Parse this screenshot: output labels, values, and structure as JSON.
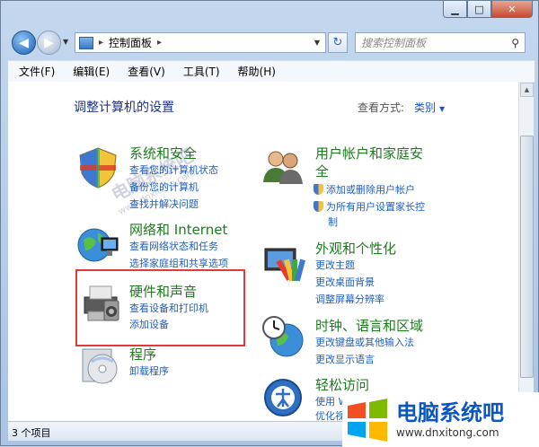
{
  "window": {
    "minimize": "▁",
    "maximize": "□",
    "close": "✕"
  },
  "nav": {
    "address": "控制面板",
    "address_sep": "▸",
    "search_placeholder": "搜索控制面板"
  },
  "menu": [
    "文件(F)",
    "编辑(E)",
    "查看(V)",
    "工具(T)",
    "帮助(H)"
  ],
  "content": {
    "heading": "调整计算机的设置",
    "view_by_label": "查看方式:",
    "view_by_value": "类别",
    "categories": [
      {
        "title": "系统和安全",
        "links": [
          "查看您的计算机状态",
          "备份您的计算机",
          "查找并解决问题"
        ]
      },
      {
        "title": "网络和 Internet",
        "links": [
          "查看网络状态和任务",
          "选择家庭组和共享选项"
        ]
      },
      {
        "title": "硬件和声音",
        "links": [
          "查看设备和打印机",
          "添加设备"
        ]
      },
      {
        "title": "程序",
        "links": [
          "卸载程序"
        ]
      },
      {
        "title_line1": "用户帐户和家庭安",
        "title_line2": "全",
        "links": [
          "添加或删除用户帐户",
          "为所有用户设置家长控",
          "制"
        ]
      },
      {
        "title": "外观和个性化",
        "links": [
          "更改主题",
          "更改桌面背景",
          "调整屏幕分辨率"
        ]
      },
      {
        "title": "时钟、语言和区域",
        "links": [
          "更改键盘或其他输入法",
          "更改显示语言"
        ]
      },
      {
        "title": "轻松访问",
        "links": [
          "使用 Windows 建议的设置",
          "优化视频显示"
        ]
      }
    ]
  },
  "status": {
    "text": "3 个项目"
  },
  "watermark": {
    "center_text": "电脑系统吧",
    "center_url": "www.dnxitong.com",
    "badge_text": "电脑系统吧",
    "badge_url": "www.dnxitong.com"
  },
  "colors": {
    "link": "#1f5fbf",
    "category": "#1e7a1e",
    "heading": "#1e3287",
    "highlight": "#e23a3a"
  },
  "icons": [
    "back-arrow-icon",
    "forward-arrow-icon",
    "control-panel-icon",
    "refresh-icon",
    "search-icon",
    "security-shield-icon",
    "network-globe-icon",
    "printer-icon",
    "programs-disc-icon",
    "users-icon",
    "appearance-palette-icon",
    "clock-globe-icon",
    "ease-of-access-icon"
  ]
}
